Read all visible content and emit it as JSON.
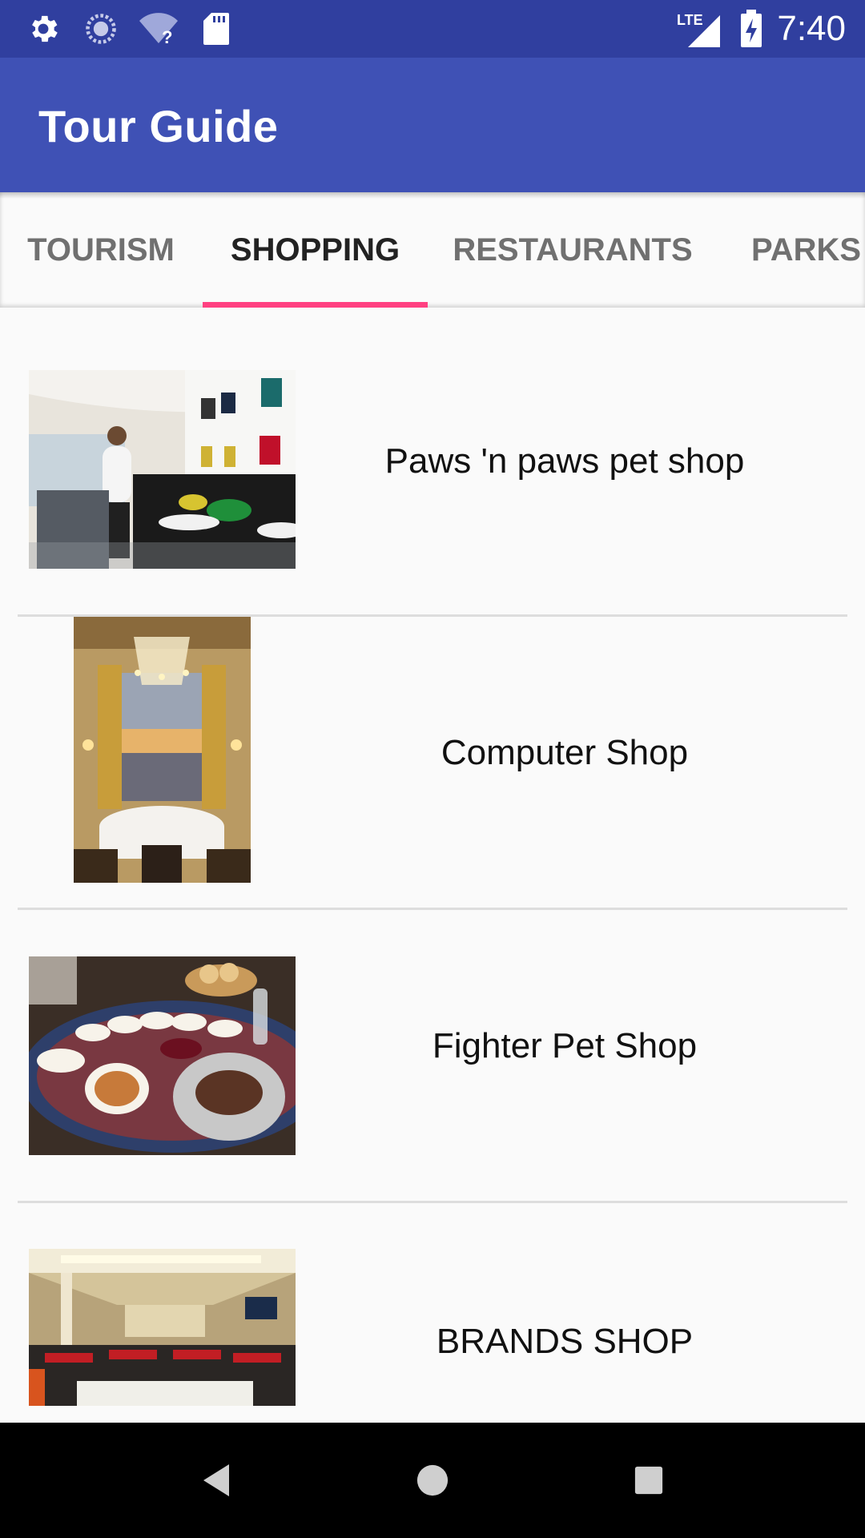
{
  "status_bar": {
    "time": "7:40",
    "network_label": "LTE",
    "icons": [
      "gear-icon",
      "sync-icon",
      "wifi-unknown-icon",
      "sd-card-icon",
      "signal-icon",
      "battery-charging-icon"
    ]
  },
  "app_bar": {
    "title": "Tour Guide"
  },
  "tabs": [
    {
      "label": "TOURISM",
      "selected": false
    },
    {
      "label": "SHOPPING",
      "selected": true
    },
    {
      "label": "RESTAURANTS",
      "selected": false
    },
    {
      "label": "PARKS",
      "selected": false
    }
  ],
  "accent_color": "#ff4081",
  "primary_color": "#3f51b5",
  "primary_dark_color": "#303f9f",
  "items": [
    {
      "label": "Paws 'n paws pet shop",
      "image": "restaurant-interior-photo"
    },
    {
      "label": "Computer Shop",
      "image": "chandelier-dining-photo"
    },
    {
      "label": "Fighter Pet Shop",
      "image": "food-platter-photo"
    },
    {
      "label": "BRANDS SHOP",
      "image": "banquet-hall-photo"
    }
  ],
  "nav_bar": {
    "icons": [
      "back-icon",
      "home-icon",
      "recents-icon"
    ]
  }
}
